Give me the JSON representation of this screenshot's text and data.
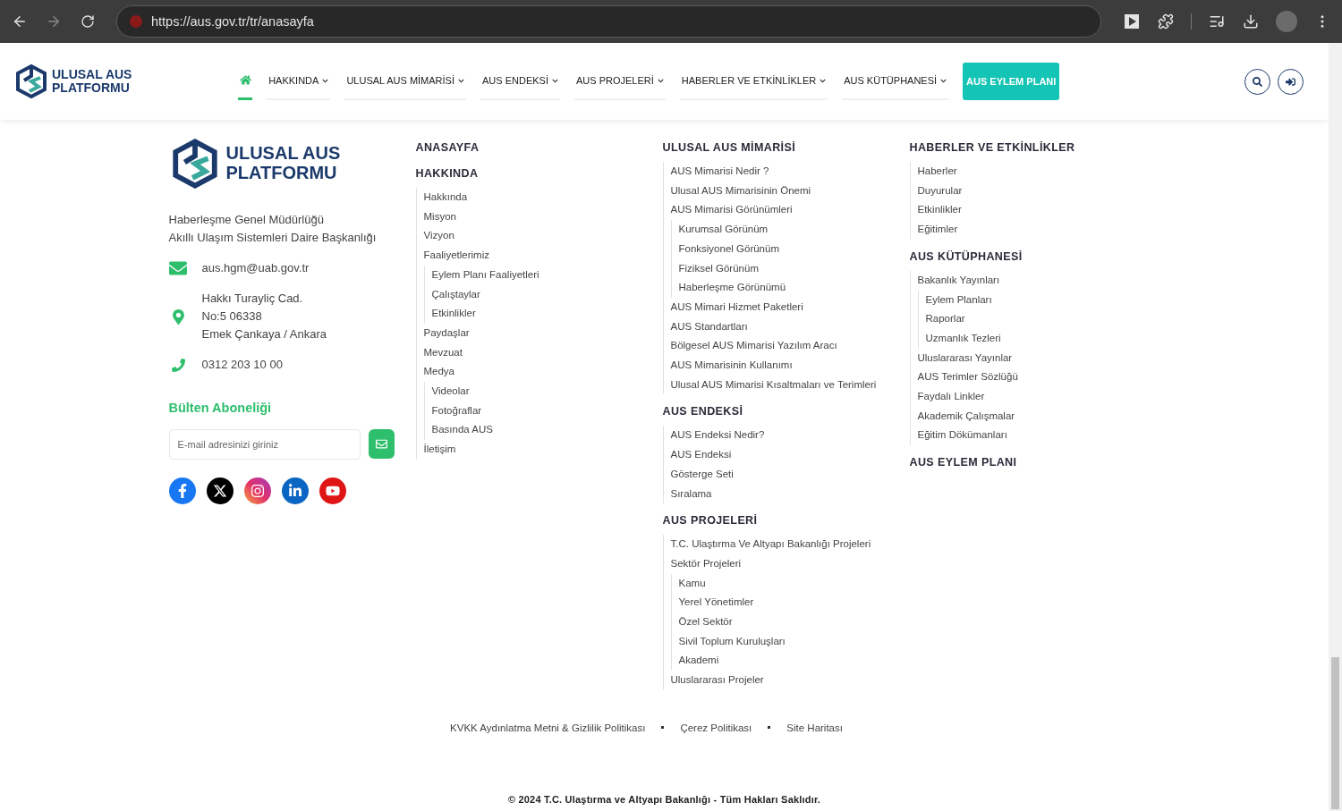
{
  "browser": {
    "url": "https://aus.gov.tr/tr/anasayfa"
  },
  "header": {
    "logo": [
      "ULUSAL AUS",
      "PLATFORMU"
    ],
    "nav": [
      {
        "kind": "home",
        "selected": true
      },
      {
        "kind": "menu",
        "label": "HAKKINDA",
        "selected": false
      },
      {
        "kind": "menu",
        "label": "ULUSAL AUS MİMARİSİ",
        "selected": false
      },
      {
        "kind": "menu",
        "label": "AUS ENDEKSİ",
        "selected": false
      },
      {
        "kind": "menu",
        "label": "AUS PROJELERİ",
        "selected": false
      },
      {
        "kind": "menu",
        "label": "HABERLER VE ETKİNLİKLER",
        "selected": false
      },
      {
        "kind": "menu",
        "label": "AUS KÜTÜPHANESİ",
        "selected": false
      },
      {
        "kind": "cta",
        "label": "AUS EYLEM PLANI",
        "selected": false
      }
    ]
  },
  "footer": {
    "logo": [
      "ULUSAL AUS",
      "PLATFORMU"
    ],
    "organization": [
      "Haberleşme Genel Müdürlüğü",
      "Akıllı Ulaşım Sistemleri Daire Başkanlığı"
    ],
    "contacts": [
      {
        "kind": "email",
        "lines": [
          "aus.hgm@uab.gov.tr"
        ]
      },
      {
        "kind": "address",
        "lines": [
          "Hakkı Turayliç Cad.",
          "No:5 06338",
          "Emek Çankaya / Ankara"
        ]
      },
      {
        "kind": "phone",
        "lines": [
          "0312 203 10 00"
        ]
      }
    ],
    "newsletter": {
      "title": "Bülten Aboneliği",
      "placeholder": "E-mail adresinizi giriniz"
    },
    "socials": [
      {
        "kind": "facebook"
      },
      {
        "kind": "x"
      },
      {
        "kind": "instagram"
      },
      {
        "kind": "linkedin"
      },
      {
        "kind": "youtube"
      }
    ],
    "sitemap": [
      [
        {
          "title": "ANASAYFA"
        },
        {
          "title": "HAKKINDA",
          "items": [
            {
              "label": "Hakkında"
            },
            {
              "label": "Misyon"
            },
            {
              "label": "Vizyon"
            },
            {
              "label": "Faaliyetlerimiz",
              "children": [
                {
                  "label": "Eylem Planı Faaliyetleri"
                },
                {
                  "label": "Çalıştaylar"
                },
                {
                  "label": "Etkinlikler"
                }
              ]
            },
            {
              "label": "Paydaşlar"
            },
            {
              "label": "Mevzuat"
            },
            {
              "label": "Medya",
              "children": [
                {
                  "label": "Videolar"
                },
                {
                  "label": "Fotoğraflar"
                },
                {
                  "label": "Basında AUS"
                }
              ]
            },
            {
              "label": "İletişim"
            }
          ]
        }
      ],
      [
        {
          "title": "ULUSAL AUS MİMARİSİ",
          "items": [
            {
              "label": "AUS Mimarisi Nedir ?"
            },
            {
              "label": "Ulusal AUS Mimarisinin Önemi"
            },
            {
              "label": "AUS Mimarisi Görünümleri",
              "children": [
                {
                  "label": "Kurumsal Görünüm"
                },
                {
                  "label": "Fonksiyonel Görünüm"
                },
                {
                  "label": "Fiziksel Görünüm"
                },
                {
                  "label": "Haberleşme Görünümü"
                }
              ]
            },
            {
              "label": "AUS Mimari Hizmet Paketleri"
            },
            {
              "label": "AUS Standartları"
            },
            {
              "label": "Bölgesel AUS Mimarisi Yazılım Aracı"
            },
            {
              "label": "AUS Mimarisinin Kullanımı"
            },
            {
              "label": "Ulusal AUS Mimarisi Kısaltmaları ve Terimleri"
            }
          ]
        },
        {
          "title": "AUS ENDEKSİ",
          "items": [
            {
              "label": "AUS Endeksi Nedir?"
            },
            {
              "label": "AUS Endeksi"
            },
            {
              "label": "Gösterge Seti"
            },
            {
              "label": "Sıralama"
            }
          ]
        },
        {
          "title": "AUS PROJELERİ",
          "items": [
            {
              "label": "T.C. Ulaştırma Ve Altyapı Bakanlığı Projeleri"
            },
            {
              "label": "Sektör Projeleri",
              "children": [
                {
                  "label": "Kamu"
                },
                {
                  "label": "Yerel Yönetimler"
                },
                {
                  "label": "Özel Sektör"
                },
                {
                  "label": "Sivil Toplum Kuruluşları"
                },
                {
                  "label": "Akademi"
                }
              ]
            },
            {
              "label": "Uluslararası Projeler"
            }
          ]
        }
      ],
      [
        {
          "title": "HABERLER VE ETKİNLİKLER",
          "items": [
            {
              "label": "Haberler"
            },
            {
              "label": "Duyurular"
            },
            {
              "label": "Etkinlikler"
            },
            {
              "label": "Eğitimler"
            }
          ]
        },
        {
          "title": "AUS KÜTÜPHANESİ",
          "items": [
            {
              "label": "Bakanlık Yayınları",
              "children": [
                {
                  "label": "Eylem Planları"
                },
                {
                  "label": "Raporlar"
                },
                {
                  "label": "Uzmanlık Tezleri"
                }
              ]
            },
            {
              "label": "Uluslararası Yayınlar"
            },
            {
              "label": "AUS Terimler Sözlüğü"
            },
            {
              "label": "Faydalı Linkler"
            },
            {
              "label": "Akademik Çalışmalar"
            },
            {
              "label": "Eğitim Dökümanları"
            }
          ]
        },
        {
          "title": "AUS EYLEM PLANI"
        }
      ]
    ],
    "legal_links": [
      "KVKK Aydınlatma Metni & Gizlilik Politikası",
      "Çerez Politikası",
      "Site Haritası"
    ],
    "copyright": "© 2024 T.C. Ulaştırma ve Altyapı Bakanlığı - Tüm Hakları Saklıdır."
  }
}
